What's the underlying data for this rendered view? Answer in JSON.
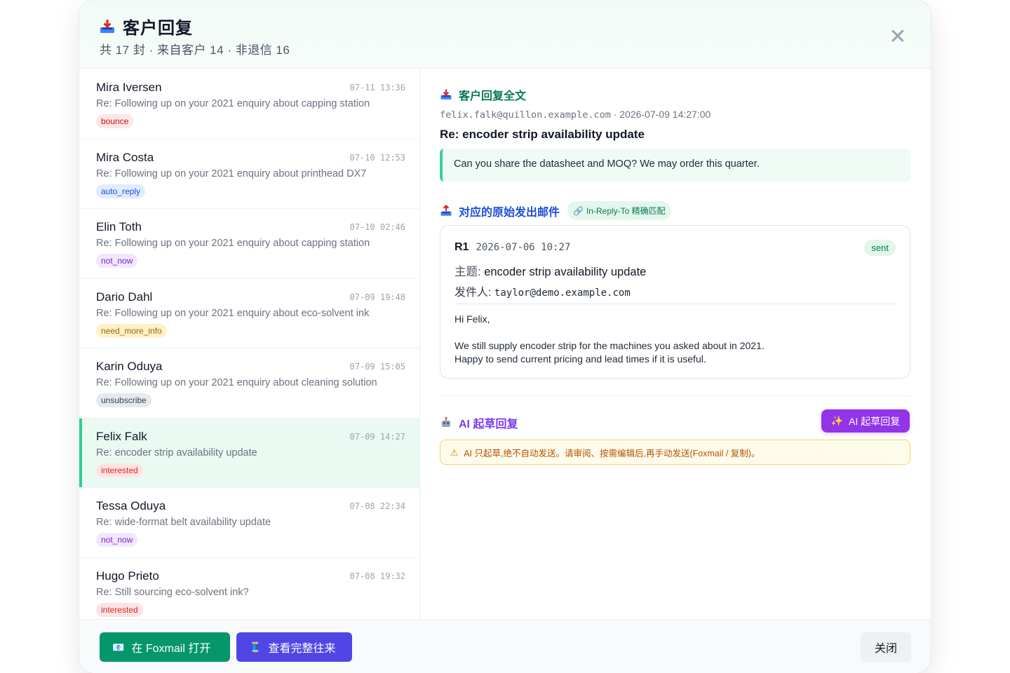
{
  "header": {
    "title": "客户回复",
    "subtitle": "共 17 封 · 来自客户 14 · 非退信 16"
  },
  "list": [
    {
      "name": "Mira Iversen",
      "time": "07-11 13:36",
      "subject": "Re: Following up on your 2021 enquiry about capping station",
      "tag": "bounce",
      "active": false
    },
    {
      "name": "Mira Costa",
      "time": "07-10 12:53",
      "subject": "Re: Following up on your 2021 enquiry about printhead DX7",
      "tag": "auto_reply",
      "active": false
    },
    {
      "name": "Elin Toth",
      "time": "07-10 02:46",
      "subject": "Re: Following up on your 2021 enquiry about capping station",
      "tag": "not_now",
      "active": false
    },
    {
      "name": "Dario Dahl",
      "time": "07-09 19:48",
      "subject": "Re: Following up on your 2021 enquiry about eco-solvent ink",
      "tag": "need_more_info",
      "active": false
    },
    {
      "name": "Karin Oduya",
      "time": "07-09 15:05",
      "subject": "Re: Following up on your 2021 enquiry about cleaning solution",
      "tag": "unsubscribe",
      "active": false
    },
    {
      "name": "Felix Falk",
      "time": "07-09 14:27",
      "subject": "Re: encoder strip availability update",
      "tag": "interested",
      "active": true
    },
    {
      "name": "Tessa Oduya",
      "time": "07-08 22:34",
      "subject": "Re: wide-format belt availability update",
      "tag": "not_now",
      "active": false
    },
    {
      "name": "Hugo Prieto",
      "time": "07-08 19:32",
      "subject": "Re: Still sourcing eco-solvent ink?",
      "tag": "interested",
      "active": false
    }
  ],
  "detail": {
    "reply_section_title": "客户回复全文",
    "from_email": "felix.falk@quillon.example.com",
    "received_at": "2026-07-09 14:27:00",
    "subject": "Re: encoder strip availability update",
    "body": "Can you share the datasheet and MOQ? We may order this quarter.",
    "original_section_title": "对应的原始发出邮件",
    "match_badge": "In-Reply-To 精确匹配",
    "original": {
      "id": "R1",
      "date": "2026-07-06 10:27",
      "status": "sent",
      "subject_label": "主题:",
      "subject": "encoder strip availability update",
      "from_label": "发件人:",
      "from_email": "taylor@demo.example.com",
      "greeting": "Hi Felix,",
      "line1": "We still supply encoder strip for the machines you asked about in 2021.",
      "line2": "Happy to send current pricing and lead times if it is useful."
    },
    "ai_section_title": "AI 起草回复",
    "ai_button": "AI 起草回复",
    "warning": "AI 只起草,绝不自动发送。请审阅、按需编辑后,再手动发送(Foxmail / 复制)。"
  },
  "footer": {
    "foxmail_button": "在 Foxmail 打开",
    "thread_button": "查看完整往来",
    "close_button": "关闭"
  },
  "icons": {
    "inbox": "inbox-tray-icon",
    "close": "close-icon",
    "link": "link-icon",
    "robot": "robot-icon",
    "sparkles": "sparkles-icon",
    "warning": "warning-icon",
    "envelope": "envelope-icon",
    "spool": "thread-spool-icon"
  },
  "colors": {
    "accent_green": "#059669",
    "accent_indigo": "#4f46e5",
    "accent_purple": "#9333ea",
    "active_row": "#eafaf2"
  }
}
